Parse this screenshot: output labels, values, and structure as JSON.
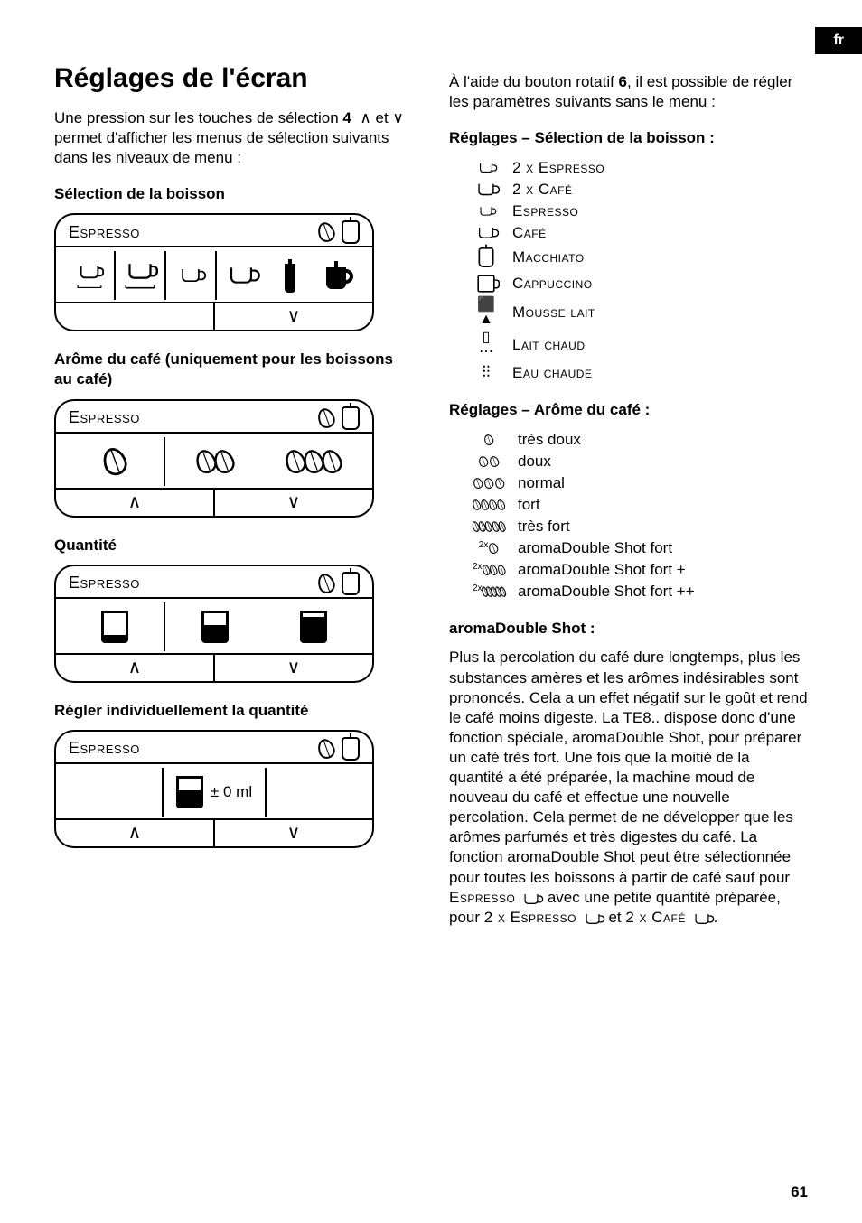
{
  "lang_tab": "fr",
  "page_number": "61",
  "left": {
    "h1": "Réglages de l'écran",
    "intro_a": "Une pression sur les touches de sélection ",
    "intro_b": " et ",
    "intro_c": " permet d'afficher les menus de sélection suivants dans les niveaux de menu :",
    "key4": "4",
    "sec_drink": "Sélection de la boisson",
    "sec_aroma": "Arôme du café (uniquement pour les boissons au café)",
    "sec_qty": "Quantité",
    "sec_indiv": "Régler individuellement la quantité",
    "screen_title": "Espresso",
    "ml_label": "± 0 ml"
  },
  "right": {
    "intro": "À l'aide du bouton rotatif 6, il est possible de régler les paramètres suivants sans le menu :",
    "intro_plain_a": "À l'aide du bouton rotatif ",
    "intro_bold": "6",
    "intro_plain_b": ", il est possible de régler les paramètres suivants sans le menu :",
    "sec_drinks": "Réglages – Sélection de la boisson :",
    "drinks": [
      "2 x Espresso",
      "2 x Café",
      "Espresso",
      "Café",
      "Macchiato",
      "Cappuccino",
      "Mousse lait",
      "Lait chaud",
      "Eau chaude"
    ],
    "sec_strength": "Réglages – Arôme du café :",
    "strengths": [
      "très doux",
      "doux",
      "normal",
      "fort",
      "très fort",
      "aromaDouble Shot fort",
      "aromaDouble Shot fort +",
      "aromaDouble Shot fort ++"
    ],
    "strength_prefix": [
      "",
      "",
      "",
      "",
      "",
      "2x",
      "2x",
      "2x"
    ],
    "ads_head": "aromaDouble Shot :",
    "ads_body_a": "Plus la percolation du café dure longtemps, plus les substances amères et les arômes indésirables sont prononcés. Cela a un effet négatif sur le goût et rend le café moins digeste. La TE8.. dispose donc d'une fonction spéciale, aromaDouble Shot, pour préparer un café très fort. Une fois que la moitié de la quantité a été préparée, la machine moud de nouveau du café et effectue une nouvelle percolation. Cela permet de ne développer que les arômes parfumés et très digestes du café. La fonction aromaDouble Shot peut être sélectionnée pour toutes les boissons à partir de café sauf pour ",
    "ads_espresso": "Espresso",
    "ads_body_b": " avec une petite quantité préparée, pour ",
    "ads_2xesp": "2 x Espresso",
    "ads_body_c": " et ",
    "ads_2xcafe": "2 x Café",
    "ads_body_d": "."
  }
}
